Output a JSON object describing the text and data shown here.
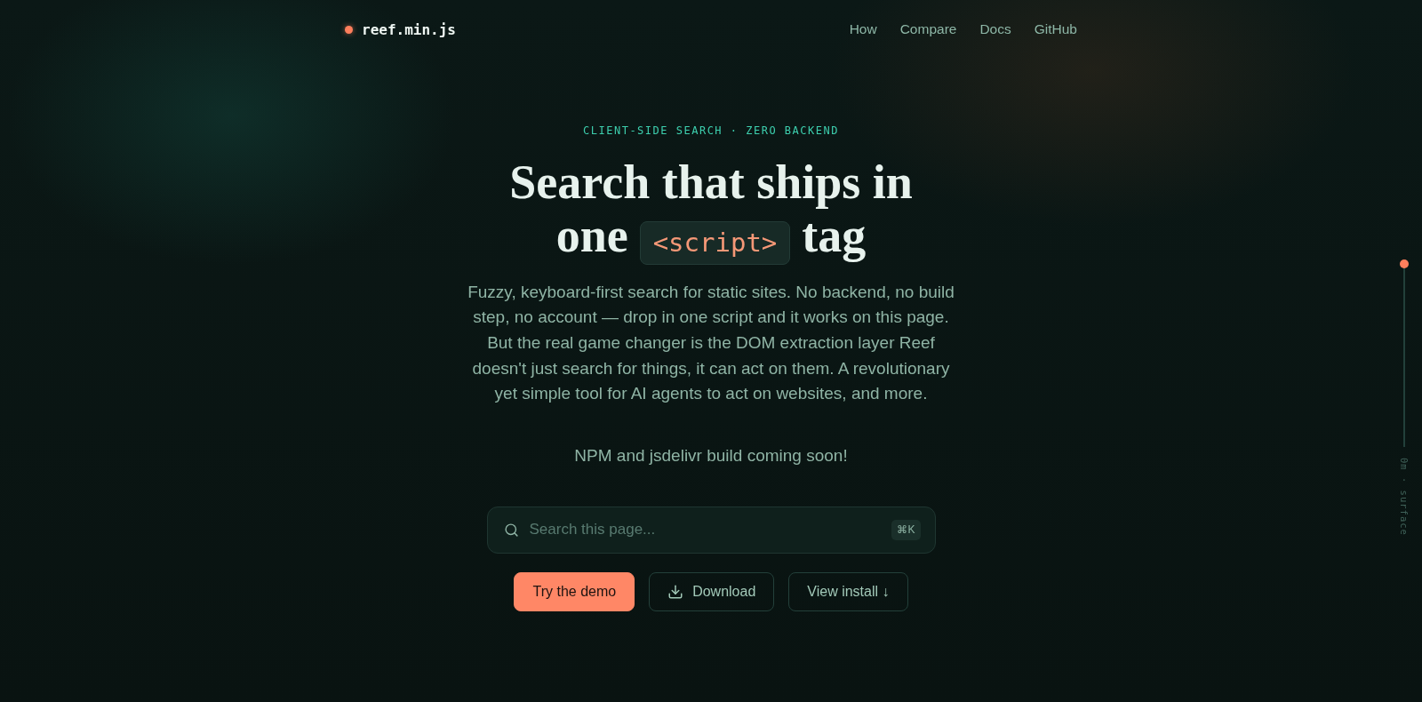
{
  "brand": {
    "name": "reef.min.js"
  },
  "nav": [
    {
      "label": "How"
    },
    {
      "label": "Compare"
    },
    {
      "label": "Docs"
    },
    {
      "label": "GitHub"
    }
  ],
  "hero": {
    "eyebrow": "CLIENT-SIDE SEARCH · ZERO BACKEND",
    "title_lines": [
      {
        "segments": [
          {
            "kind": "text",
            "text": "Search that ships in"
          }
        ]
      },
      {
        "segments": [
          {
            "kind": "text",
            "text": "one"
          },
          {
            "kind": "code",
            "text": "<script>"
          },
          {
            "kind": "text",
            "text": "tag"
          }
        ]
      }
    ],
    "description": "Fuzzy, keyboard-first search for static sites. No backend, no build step, no account — drop in one script and it works on this page. But the real game changer is the DOM extraction layer Reef doesn't just search for things, it can act on them. A revolutionary yet simple tool for AI agents to act on websites, and more.",
    "note": "NPM and jsdelivr build coming soon!"
  },
  "search": {
    "placeholder": "Search this page...",
    "shortcut": "⌘K"
  },
  "actions": [
    {
      "label": "Try the demo",
      "kind": "primary"
    },
    {
      "label": "Download",
      "kind": "download"
    },
    {
      "label": "View install ↓",
      "kind": "secondary"
    }
  ],
  "depth_gauge": {
    "label": "0m · surface"
  }
}
